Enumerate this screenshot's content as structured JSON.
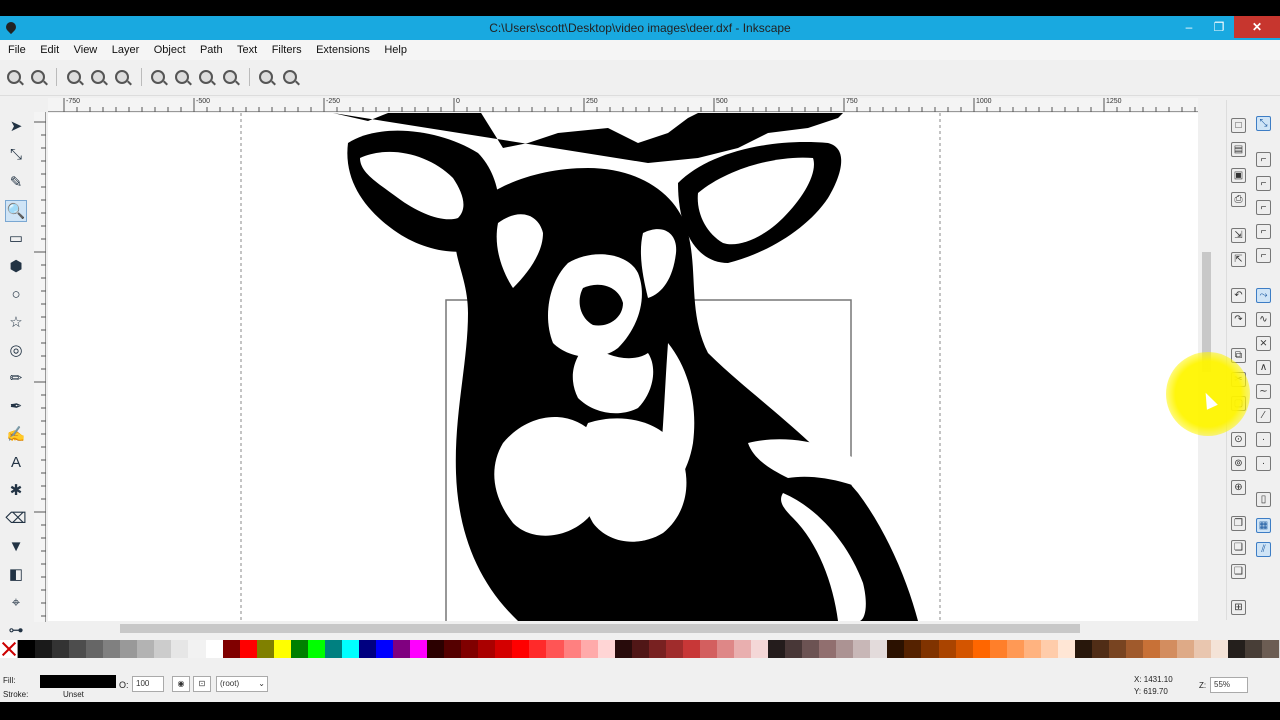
{
  "window": {
    "title": "C:\\Users\\scott\\Desktop\\video images\\deer.dxf - Inkscape",
    "minimize": "–",
    "maximize": "❐",
    "close": "✕"
  },
  "menu": [
    "File",
    "Edit",
    "View",
    "Layer",
    "Object",
    "Path",
    "Text",
    "Filters",
    "Extensions",
    "Help"
  ],
  "ruler_labels": [
    "-750",
    "-500",
    "-250",
    "0",
    "250",
    "500",
    "750",
    "1000",
    "1250"
  ],
  "tools": [
    {
      "name": "selector-tool",
      "glyph": "➤"
    },
    {
      "name": "node-tool",
      "glyph": "⤡"
    },
    {
      "name": "tweak-tool",
      "glyph": "✎"
    },
    {
      "name": "zoom-tool",
      "glyph": "🔍"
    },
    {
      "name": "rectangle-tool",
      "glyph": "▭"
    },
    {
      "name": "3d-box-tool",
      "glyph": "⬢"
    },
    {
      "name": "ellipse-tool",
      "glyph": "○"
    },
    {
      "name": "star-tool",
      "glyph": "☆"
    },
    {
      "name": "spiral-tool",
      "glyph": "◎"
    },
    {
      "name": "pencil-tool",
      "glyph": "✏"
    },
    {
      "name": "pen-tool",
      "glyph": "✒"
    },
    {
      "name": "calligraphy-tool",
      "glyph": "✍"
    },
    {
      "name": "text-tool",
      "glyph": "A"
    },
    {
      "name": "spray-tool",
      "glyph": "✱"
    },
    {
      "name": "eraser-tool",
      "glyph": "⌫"
    },
    {
      "name": "paint-bucket-tool",
      "glyph": "▼"
    },
    {
      "name": "gradient-tool",
      "glyph": "◧"
    },
    {
      "name": "dropper-tool",
      "glyph": "⌖"
    },
    {
      "name": "connector-tool",
      "glyph": "⊶"
    }
  ],
  "palette": [
    "#000000",
    "#1a1a1a",
    "#333333",
    "#4d4d4d",
    "#666666",
    "#808080",
    "#999999",
    "#b3b3b3",
    "#cccccc",
    "#e6e6e6",
    "#f2f2f2",
    "#ffffff",
    "#800000",
    "#ff0000",
    "#808000",
    "#ffff00",
    "#008000",
    "#00ff00",
    "#008080",
    "#00ffff",
    "#000080",
    "#0000ff",
    "#800080",
    "#ff00ff",
    "#2b0000",
    "#550000",
    "#800000",
    "#aa0000",
    "#d40000",
    "#ff0000",
    "#ff2a2a",
    "#ff5555",
    "#ff8080",
    "#ffaaaa",
    "#ffd5d5",
    "#280b0b",
    "#501616",
    "#782121",
    "#a02c2c",
    "#c83737",
    "#d35f5f",
    "#de8787",
    "#e9afaf",
    "#f4d7d7",
    "#241c1c",
    "#483737",
    "#6c5353",
    "#916f6f",
    "#ac9393",
    "#c8b7b7",
    "#e3dbdb",
    "#2b1100",
    "#552200",
    "#803300",
    "#aa4400",
    "#d45500",
    "#ff6600",
    "#ff7f2a",
    "#ff9955",
    "#ffb380",
    "#ffccaa",
    "#ffe6d5",
    "#28170b",
    "#502d16",
    "#784421",
    "#a05a2c",
    "#c87137",
    "#d38d5f",
    "#deaa87",
    "#e9c6af",
    "#f4e3d7",
    "#241f1c",
    "#483e37",
    "#6c5d53"
  ],
  "status": {
    "fill_label": "Fill:",
    "stroke_label": "Stroke:",
    "stroke_value": "Unset",
    "opacity_label": "O:",
    "opacity_value": "100",
    "layer_value": "(root)",
    "x_coord": "X: 1431.10",
    "y_coord": "Y:  619.70",
    "zoom_label": "Z:",
    "zoom_value": "55%"
  }
}
